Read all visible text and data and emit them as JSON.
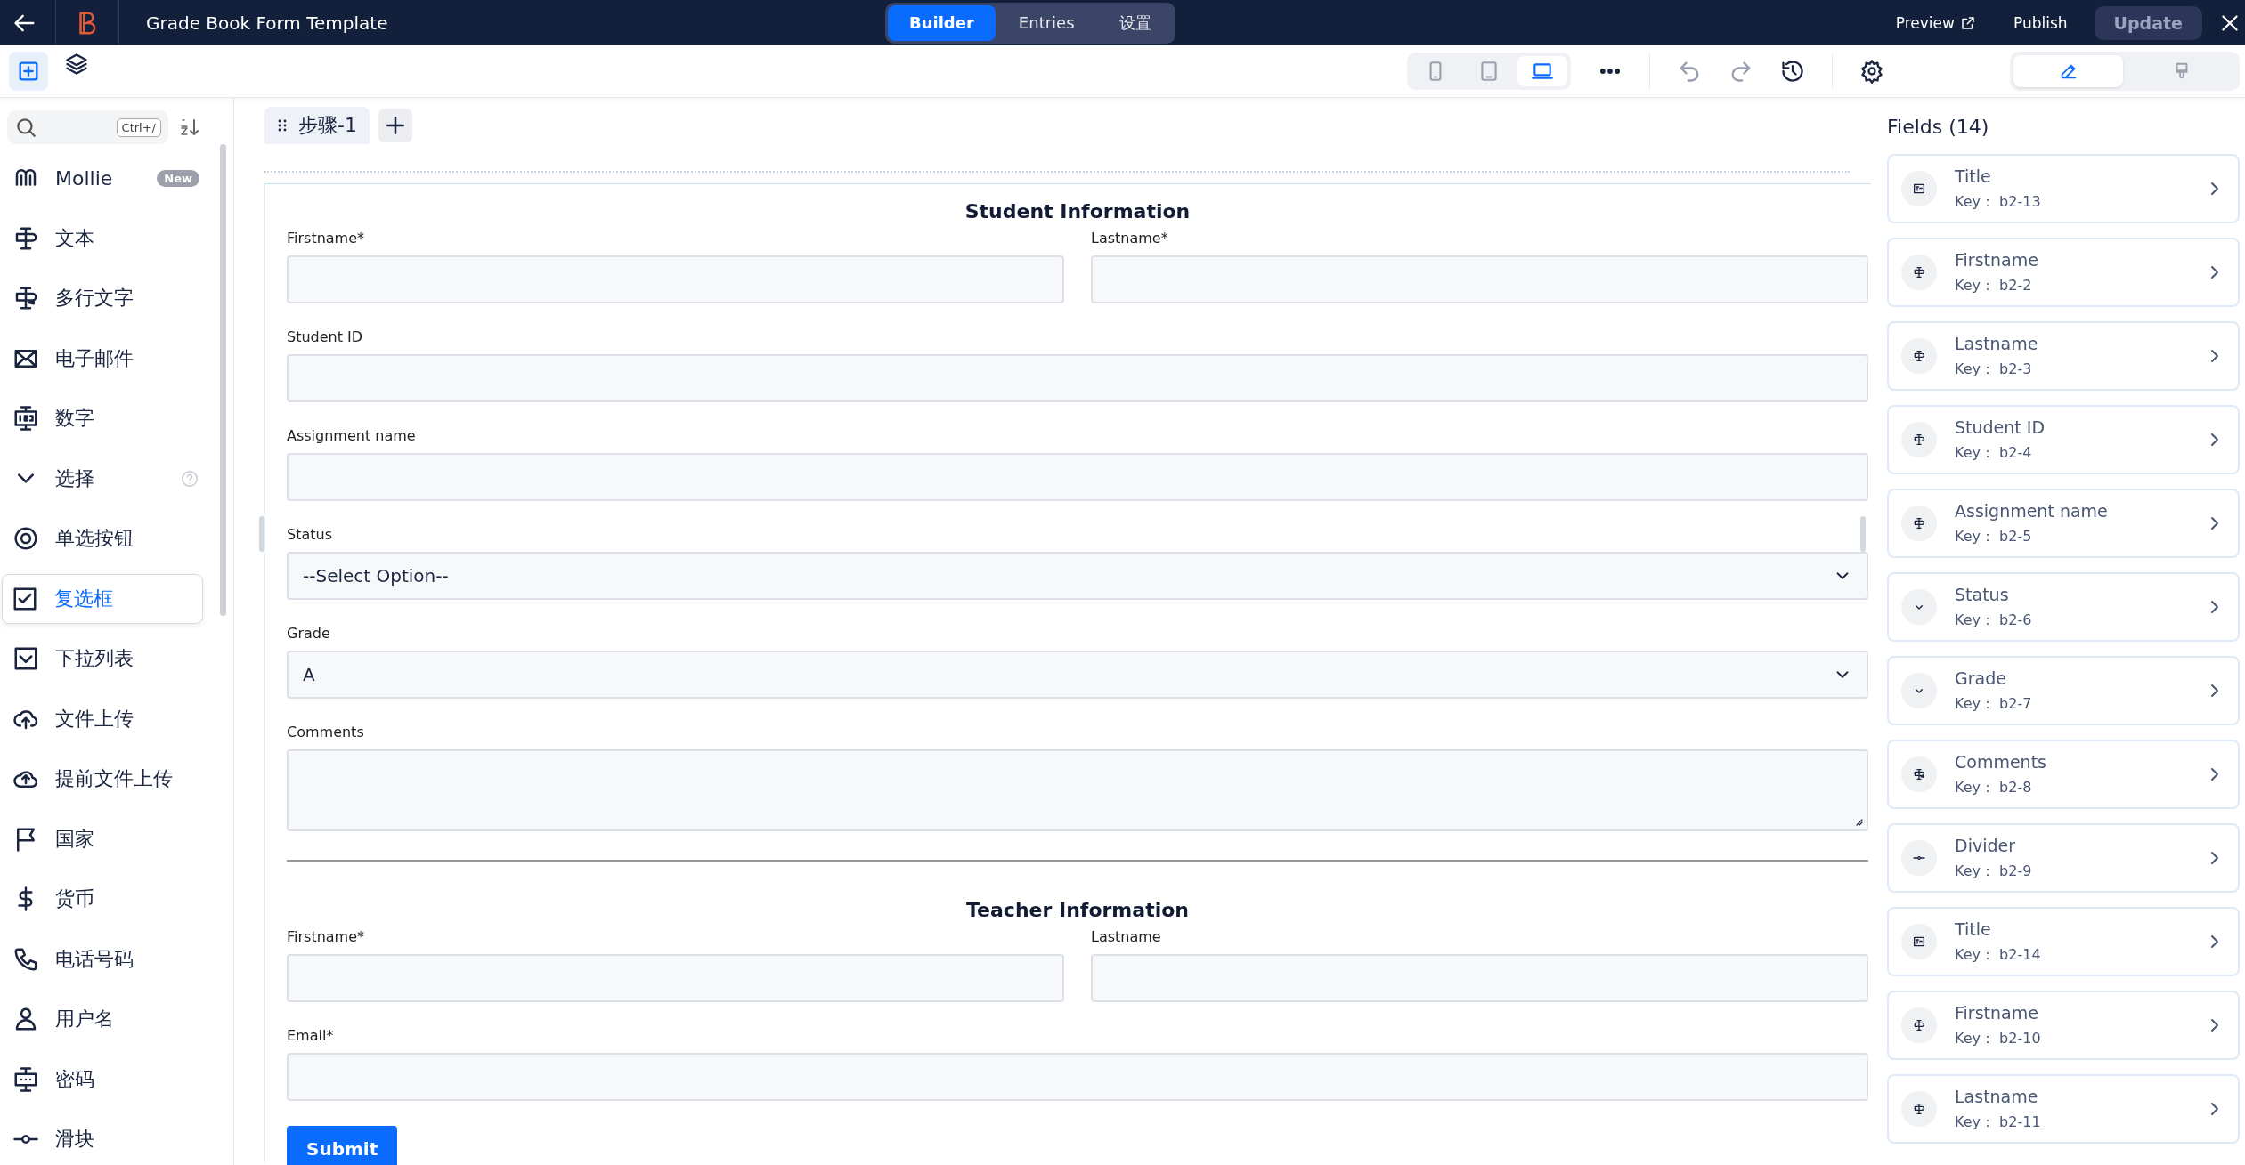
{
  "topbar": {
    "title": "Grade Book Form Template",
    "tabs": [
      {
        "label": "Builder",
        "selected": true
      },
      {
        "label": "Entries",
        "selected": false
      },
      {
        "label": "设置",
        "selected": false
      }
    ],
    "preview": "Preview",
    "publish": "Publish",
    "update": "Update"
  },
  "toolbar": {
    "devices": [
      {
        "selected": false
      },
      {
        "selected": false
      },
      {
        "selected": true
      }
    ],
    "panel_tabs": [
      {
        "selected": true
      },
      {
        "selected": false
      }
    ]
  },
  "sidebar": {
    "search_shortcut": "Ctrl+/",
    "items": [
      {
        "label": "Mollie",
        "badge": "New",
        "selected": false
      },
      {
        "label": "文本",
        "selected": false
      },
      {
        "label": "多行文字",
        "selected": false
      },
      {
        "label": "电子邮件",
        "selected": false
      },
      {
        "label": "数字",
        "selected": false
      },
      {
        "label": "选择",
        "help": true,
        "selected": false
      },
      {
        "label": "单选按钮",
        "selected": false
      },
      {
        "label": "复选框",
        "selected": true
      },
      {
        "label": "下拉列表",
        "selected": false
      },
      {
        "label": "文件上传",
        "selected": false
      },
      {
        "label": "提前文件上传",
        "selected": false
      },
      {
        "label": "国家",
        "selected": false
      },
      {
        "label": "货币",
        "selected": false
      },
      {
        "label": "电话号码",
        "selected": false
      },
      {
        "label": "用户名",
        "selected": false
      },
      {
        "label": "密码",
        "selected": false
      },
      {
        "label": "滑块",
        "selected": false
      }
    ]
  },
  "steps": [
    {
      "label": "步骤-1",
      "selected": true
    }
  ],
  "form": {
    "items": [
      {
        "kind": "heading",
        "text": "Student Information"
      },
      {
        "kind": "fields",
        "fields": [
          {
            "label": "Firstname*",
            "kind": "input"
          },
          {
            "label": "Lastname*",
            "kind": "input"
          }
        ]
      },
      {
        "kind": "fields",
        "fields": [
          {
            "label": "Student ID",
            "kind": "input"
          }
        ]
      },
      {
        "kind": "fields",
        "fields": [
          {
            "label": "Assignment name",
            "kind": "input"
          }
        ]
      },
      {
        "kind": "fields",
        "fields": [
          {
            "label": "Status",
            "kind": "select",
            "value": "--Select Option--"
          }
        ]
      },
      {
        "kind": "fields",
        "fields": [
          {
            "label": "Grade",
            "kind": "select",
            "value": "A"
          }
        ]
      },
      {
        "kind": "fields",
        "fields": [
          {
            "label": "Comments",
            "kind": "textarea"
          }
        ]
      },
      {
        "kind": "divider"
      },
      {
        "kind": "heading",
        "text": "Teacher Information"
      },
      {
        "kind": "fields",
        "fields": [
          {
            "label": "Firstname*",
            "kind": "input"
          },
          {
            "label": "Lastname",
            "kind": "input"
          }
        ]
      },
      {
        "kind": "fields",
        "fields": [
          {
            "label": "Email*",
            "kind": "input"
          }
        ]
      },
      {
        "kind": "button",
        "text": "Submit"
      }
    ]
  },
  "fields_panel": {
    "title": "Fields (14)",
    "items": [
      {
        "name": "Title",
        "key_label": "Key：",
        "key": "b2-13",
        "kind": "title"
      },
      {
        "name": "Firstname",
        "key_label": "Key：",
        "key": "b2-2",
        "kind": "text"
      },
      {
        "name": "Lastname",
        "key_label": "Key：",
        "key": "b2-3",
        "kind": "text"
      },
      {
        "name": "Student ID",
        "key_label": "Key：",
        "key": "b2-4",
        "kind": "text"
      },
      {
        "name": "Assignment name",
        "key_label": "Key：",
        "key": "b2-5",
        "kind": "text"
      },
      {
        "name": "Status",
        "key_label": "Key：",
        "key": "b2-6",
        "kind": "select"
      },
      {
        "name": "Grade",
        "key_label": "Key：",
        "key": "b2-7",
        "kind": "select"
      },
      {
        "name": "Comments",
        "key_label": "Key：",
        "key": "b2-8",
        "kind": "textarea"
      },
      {
        "name": "Divider",
        "key_label": "Key：",
        "key": "b2-9",
        "kind": "divider"
      },
      {
        "name": "Title",
        "key_label": "Key：",
        "key": "b2-14",
        "kind": "title"
      },
      {
        "name": "Firstname",
        "key_label": "Key：",
        "key": "b2-10",
        "kind": "text"
      },
      {
        "name": "Lastname",
        "key_label": "Key：",
        "key": "b2-11",
        "kind": "text"
      }
    ]
  }
}
